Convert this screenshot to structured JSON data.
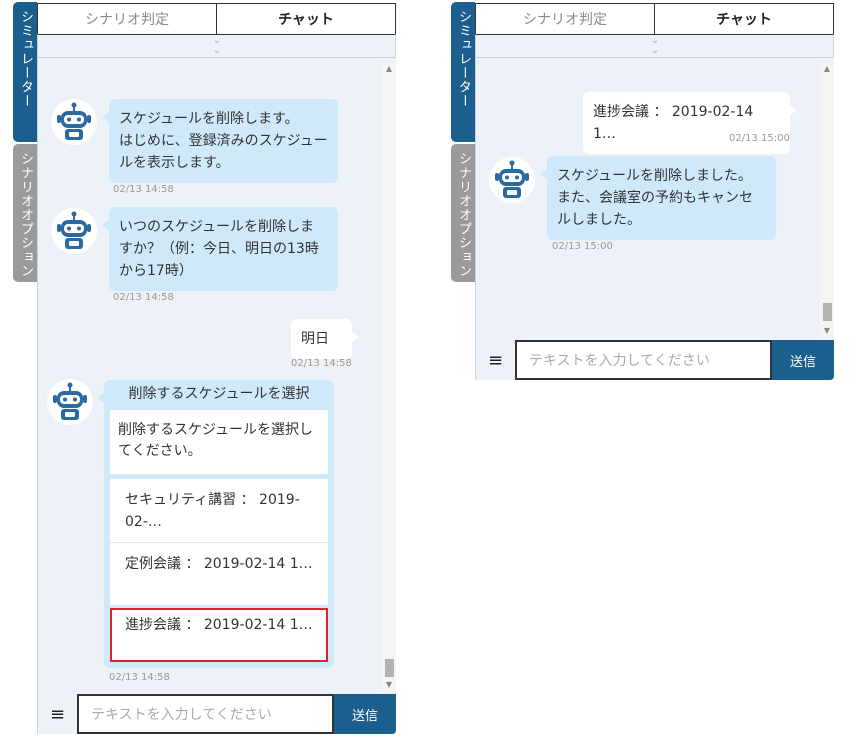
{
  "side_tabs": {
    "simulator": "シミュレーター",
    "scenario_option": "シナリオオプション"
  },
  "tabs": {
    "scenario": "シナリオ判定",
    "chat": "チャット"
  },
  "collapse_icon": "double-chevron-down-icon",
  "input": {
    "placeholder": "テキストを入力してください",
    "send": "送信",
    "menu": "≡"
  },
  "left_chat": {
    "messages": [
      {
        "text": "スケジュールを削除します。\nはじめに、登録済みのスケジュールを表示します。",
        "time": "02/13 14:58"
      },
      {
        "text": "いつのスケジュールを削除しますか？（例：今日、明日の13時から17時）",
        "time": "02/13 14:58"
      },
      {
        "text": "明日",
        "time": "02/13 14:58"
      }
    ],
    "card": {
      "title": "削除するスケジュールを選択",
      "text": "削除するスケジュールを選択してください。",
      "options": [
        "セキュリティ講習 ： 2019-02-…",
        "定例会議 ： 2019-02-14 1…",
        "進捗会議 ： 2019-02-14 1…"
      ],
      "time": "02/13 14:58"
    }
  },
  "right_chat": {
    "messages": [
      {
        "text": "進捗会議 ： 2019-02-14 1…",
        "time": "02/13 15:00"
      },
      {
        "text": "スケジュールを削除しました。\nまた、会議室の予約もキャンセルしました。",
        "time": "02/13 15:00"
      }
    ]
  },
  "colors": {
    "accent": "#1c5f8e",
    "chat_bg": "#edf1f8",
    "bubble": "#cfe9fb",
    "highlight": "#d9232d"
  }
}
